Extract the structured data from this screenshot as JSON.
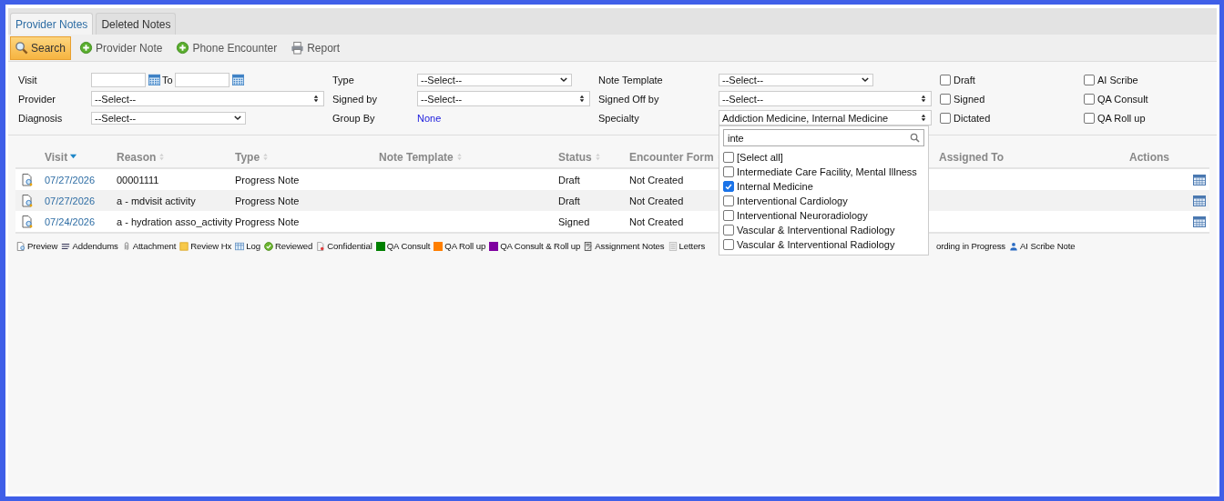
{
  "tabs": [
    {
      "label": "Provider Notes",
      "selected": true
    },
    {
      "label": "Deleted Notes",
      "selected": false
    }
  ],
  "toolbar": [
    {
      "label": "Search",
      "kind": "search",
      "active": true
    },
    {
      "label": "Provider Note",
      "kind": "add",
      "active": false
    },
    {
      "label": "Phone Encounter",
      "kind": "add",
      "active": false
    },
    {
      "label": "Report",
      "kind": "print",
      "active": false
    }
  ],
  "filters": {
    "visit": {
      "label": "Visit",
      "to_label": "To"
    },
    "provider": {
      "label": "Provider",
      "value": "--Select--"
    },
    "diagnosis": {
      "label": "Diagnosis",
      "value": "--Select--"
    },
    "type": {
      "label": "Type",
      "value": "--Select--"
    },
    "signed_by": {
      "label": "Signed by",
      "value": "--Select--"
    },
    "group_by": {
      "label": "Group By",
      "value": "None"
    },
    "note_template": {
      "label": "Note Template",
      "value": "--Select--"
    },
    "signed_off_by": {
      "label": "Signed Off by",
      "value": "--Select--"
    },
    "specialty": {
      "label": "Specialty",
      "value": "Addiction Medicine, Internal Medicine",
      "expanded": true,
      "search": "inte",
      "options": [
        {
          "label": "[Select all]",
          "checked": false
        },
        {
          "label": "Intermediate Care Facility, Mental Illness",
          "checked": false
        },
        {
          "label": "Internal Medicine",
          "checked": true
        },
        {
          "label": "Interventional Cardiology",
          "checked": false
        },
        {
          "label": "Interventional Neuroradiology",
          "checked": false
        },
        {
          "label": "Vascular & Interventional Radiology",
          "checked": false
        },
        {
          "label": "Vascular & Interventional Radiology",
          "checked": false
        }
      ]
    },
    "checkboxes": [
      {
        "label": "Draft",
        "checked": false
      },
      {
        "label": "AI Scribe",
        "checked": false
      },
      {
        "label": "Signed",
        "checked": false
      },
      {
        "label": "QA Consult",
        "checked": false
      },
      {
        "label": "Dictated",
        "checked": false
      },
      {
        "label": "QA Roll up",
        "checked": false
      }
    ]
  },
  "table": {
    "columns": [
      {
        "label": "Visit",
        "sortable": true,
        "sorted": true
      },
      {
        "label": "Reason",
        "sortable": true,
        "sorted": false
      },
      {
        "label": "Type",
        "sortable": true,
        "sorted": false
      },
      {
        "label": "Note Template",
        "sortable": true,
        "sorted": false
      },
      {
        "label": "Status",
        "sortable": true,
        "sorted": false
      },
      {
        "label": "Encounter Form",
        "sortable": true,
        "sorted": false
      },
      {
        "label": "Assigned To",
        "sortable": false
      },
      {
        "label": "Actions",
        "sortable": false
      }
    ],
    "rows": [
      {
        "visit": "07/27/2026",
        "reason": "00001111",
        "type": "Progress Note",
        "status": "Draft",
        "encounter_form": "Not Created"
      },
      {
        "visit": "07/27/2026",
        "reason": "a - mdvisit activity",
        "type": "Progress Note",
        "status": "Draft",
        "encounter_form": "Not Created"
      },
      {
        "visit": "07/24/2026",
        "reason": "a - hydration asso_activity",
        "type": "Progress Note",
        "status": "Signed",
        "encounter_form": "Not Created"
      }
    ]
  },
  "legend": [
    {
      "label": "Preview",
      "kind": "preview"
    },
    {
      "label": "Addendums",
      "kind": "lines"
    },
    {
      "label": "Attachment",
      "kind": "clip"
    },
    {
      "label": "Review Hx",
      "kind": "note"
    },
    {
      "label": "Log",
      "kind": "grid"
    },
    {
      "label": "Reviewed",
      "kind": "check"
    },
    {
      "label": "Confidential",
      "kind": "confidential"
    },
    {
      "label": "QA Consult",
      "kind": "swatch",
      "color": "#008000"
    },
    {
      "label": "QA Roll up",
      "kind": "swatch",
      "color": "#ff7f00"
    },
    {
      "label": "QA Consult & Roll up",
      "kind": "swatch",
      "color": "#7f00a0"
    },
    {
      "label": "Assignment Notes",
      "kind": "assign"
    },
    {
      "label": "Letters",
      "kind": "lines2"
    }
  ],
  "legend_right": [
    {
      "label": "ording in Progress",
      "kind": "none"
    },
    {
      "label": "AI Scribe Note",
      "kind": "person"
    }
  ]
}
